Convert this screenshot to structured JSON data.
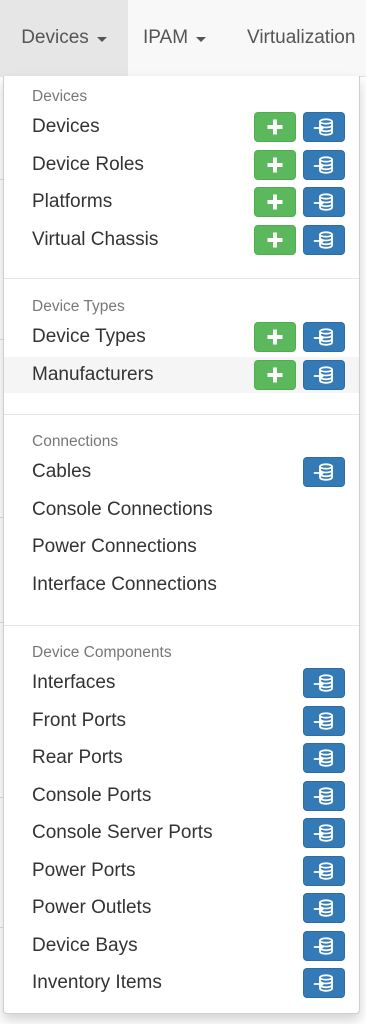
{
  "navbar": {
    "devices_label": "Devices",
    "ipam_label": "IPAM",
    "virtualization_label": "Virtualization"
  },
  "colors": {
    "add_button": "#5cb85c",
    "import_button": "#337ab7",
    "header_text": "#777777",
    "item_text": "#333333"
  },
  "icons": {
    "add": "plus-icon",
    "import": "database-import-icon"
  },
  "menu": {
    "sections": [
      {
        "header": "Devices",
        "items": [
          {
            "label": "Devices",
            "add": true,
            "import": true
          },
          {
            "label": "Device Roles",
            "add": true,
            "import": true
          },
          {
            "label": "Platforms",
            "add": true,
            "import": true
          },
          {
            "label": "Virtual Chassis",
            "add": true,
            "import": true
          }
        ]
      },
      {
        "header": "Device Types",
        "items": [
          {
            "label": "Device Types",
            "add": true,
            "import": true
          },
          {
            "label": "Manufacturers",
            "add": true,
            "import": true,
            "hovered": true
          }
        ]
      },
      {
        "header": "Connections",
        "items": [
          {
            "label": "Cables",
            "add": false,
            "import": true
          },
          {
            "label": "Console Connections",
            "add": false,
            "import": false
          },
          {
            "label": "Power Connections",
            "add": false,
            "import": false
          },
          {
            "label": "Interface Connections",
            "add": false,
            "import": false
          }
        ]
      },
      {
        "header": "Device Components",
        "items": [
          {
            "label": "Interfaces",
            "add": false,
            "import": true
          },
          {
            "label": "Front Ports",
            "add": false,
            "import": true
          },
          {
            "label": "Rear Ports",
            "add": false,
            "import": true
          },
          {
            "label": "Console Ports",
            "add": false,
            "import": true
          },
          {
            "label": "Console Server Ports",
            "add": false,
            "import": true
          },
          {
            "label": "Power Ports",
            "add": false,
            "import": true
          },
          {
            "label": "Power Outlets",
            "add": false,
            "import": true
          },
          {
            "label": "Device Bays",
            "add": false,
            "import": true
          },
          {
            "label": "Inventory Items",
            "add": false,
            "import": true
          }
        ]
      }
    ]
  }
}
